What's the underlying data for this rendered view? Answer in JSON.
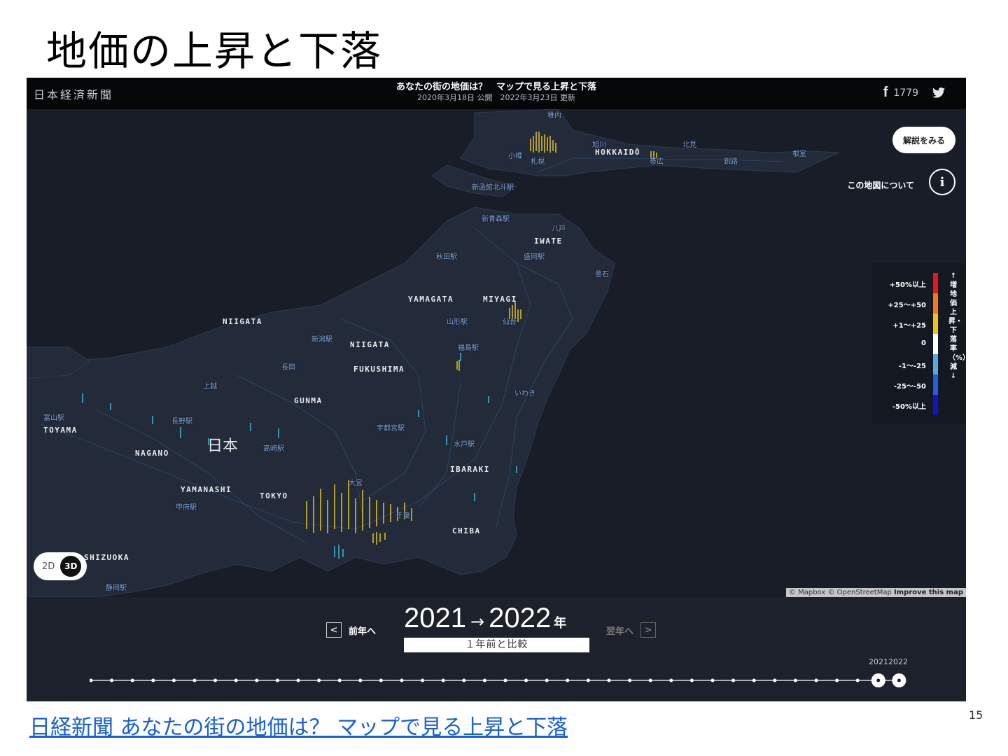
{
  "slide": {
    "title": "地価の上昇と下落",
    "footer_link": "日経新聞 あなたの街の地価は？ マップで見る上昇と下落",
    "page_number": "15"
  },
  "app": {
    "brand": "日本経済新聞",
    "headline": "あなたの街の地価は？　マップで見る上昇と下落",
    "dates": "2020年3月18日 公開　2022年3月23日 更新",
    "share_count": "1779",
    "explain_button": "解説をみる",
    "about_label": "この地図について",
    "about_icon_text": "i"
  },
  "map": {
    "labels": {
      "hokkaido": "HOKKAIDÔ",
      "iwate": "IWATE",
      "yamagata": "YAMAGATA",
      "miyagi": "MIYAGI",
      "niigata_sea": "NIIGATA",
      "niigata": "NIIGATA",
      "fukushima": "FUKUSHIMA",
      "gunma": "GUNMA",
      "toyama": "TOYAMA",
      "nagano": "NAGANO",
      "ibaraki": "IBARAKI",
      "yamanashi": "YAMANASHI",
      "tokyo": "TOKYO",
      "chiba": "CHIBA",
      "shizuoka": "SHIZUOKA",
      "japan": "日本"
    },
    "places": {
      "wakkanai": "稚内",
      "otaru": "小樽",
      "sapporo": "札幌",
      "asahikawa": "旭川",
      "kitami": "北見",
      "obihiro": "帯広",
      "kushiro": "釧路",
      "nemuro": "根室",
      "hakodate": "新函館北斗駅",
      "aomori": "新青森駅",
      "hachinohe": "八戸",
      "akita": "秋田駅",
      "morioka": "盛岡駅",
      "kamaishi": "釜石",
      "yamagata_st": "山形駅",
      "sendai": "仙台",
      "niigata_st": "新潟駅",
      "fukushima_st": "福島駅",
      "nagaoka": "長岡",
      "joetsu": "上越",
      "iwaki": "いわき",
      "toyama_st": "富山駅",
      "nagano_st": "長野駅",
      "utsunomiya": "宇都宮駅",
      "takasaki": "高崎駅",
      "mito": "水戸駅",
      "omiya": "大宮",
      "kofu": "甲府駅",
      "chiba_st": "千葉",
      "shizuoka_st": "静岡駅"
    },
    "legend": {
      "items": [
        {
          "label": "+50%以上",
          "color": "#e8151a"
        },
        {
          "label": "+25〜+50",
          "color": "#f07a1a"
        },
        {
          "label": "+1〜+25",
          "color": "#f2c21b"
        },
        {
          "label": "0",
          "color": "#ffffff"
        },
        {
          "label": "-1〜-25",
          "color": "#5aa7e6"
        },
        {
          "label": "-25〜-50",
          "color": "#1f5fe0"
        },
        {
          "label": "-50%以上",
          "color": "#1212c8"
        }
      ],
      "axis_label": "↑増　地価上昇・下落率（%）　減↓"
    },
    "view_toggle": {
      "option_2d": "2D",
      "option_3d": "3D",
      "selected": "3D"
    },
    "attribution": {
      "text": "© Mapbox © OpenStreetMap",
      "improve": "Improve this map"
    }
  },
  "controls": {
    "prev_label": "前年へ",
    "next_label": "翌年へ",
    "from_year": "2021",
    "arrow": "→",
    "to_year": "2022",
    "year_unit": "年",
    "compare_label": "１年前と比較",
    "timeline_label": "20212022",
    "timeline_points": 40,
    "timeline_selected": [
      38,
      39
    ]
  },
  "colors": {
    "map_bg": "#181d28",
    "land": "#242b3a",
    "rise": "#f2d21b",
    "fall": "#3fc4e6"
  }
}
